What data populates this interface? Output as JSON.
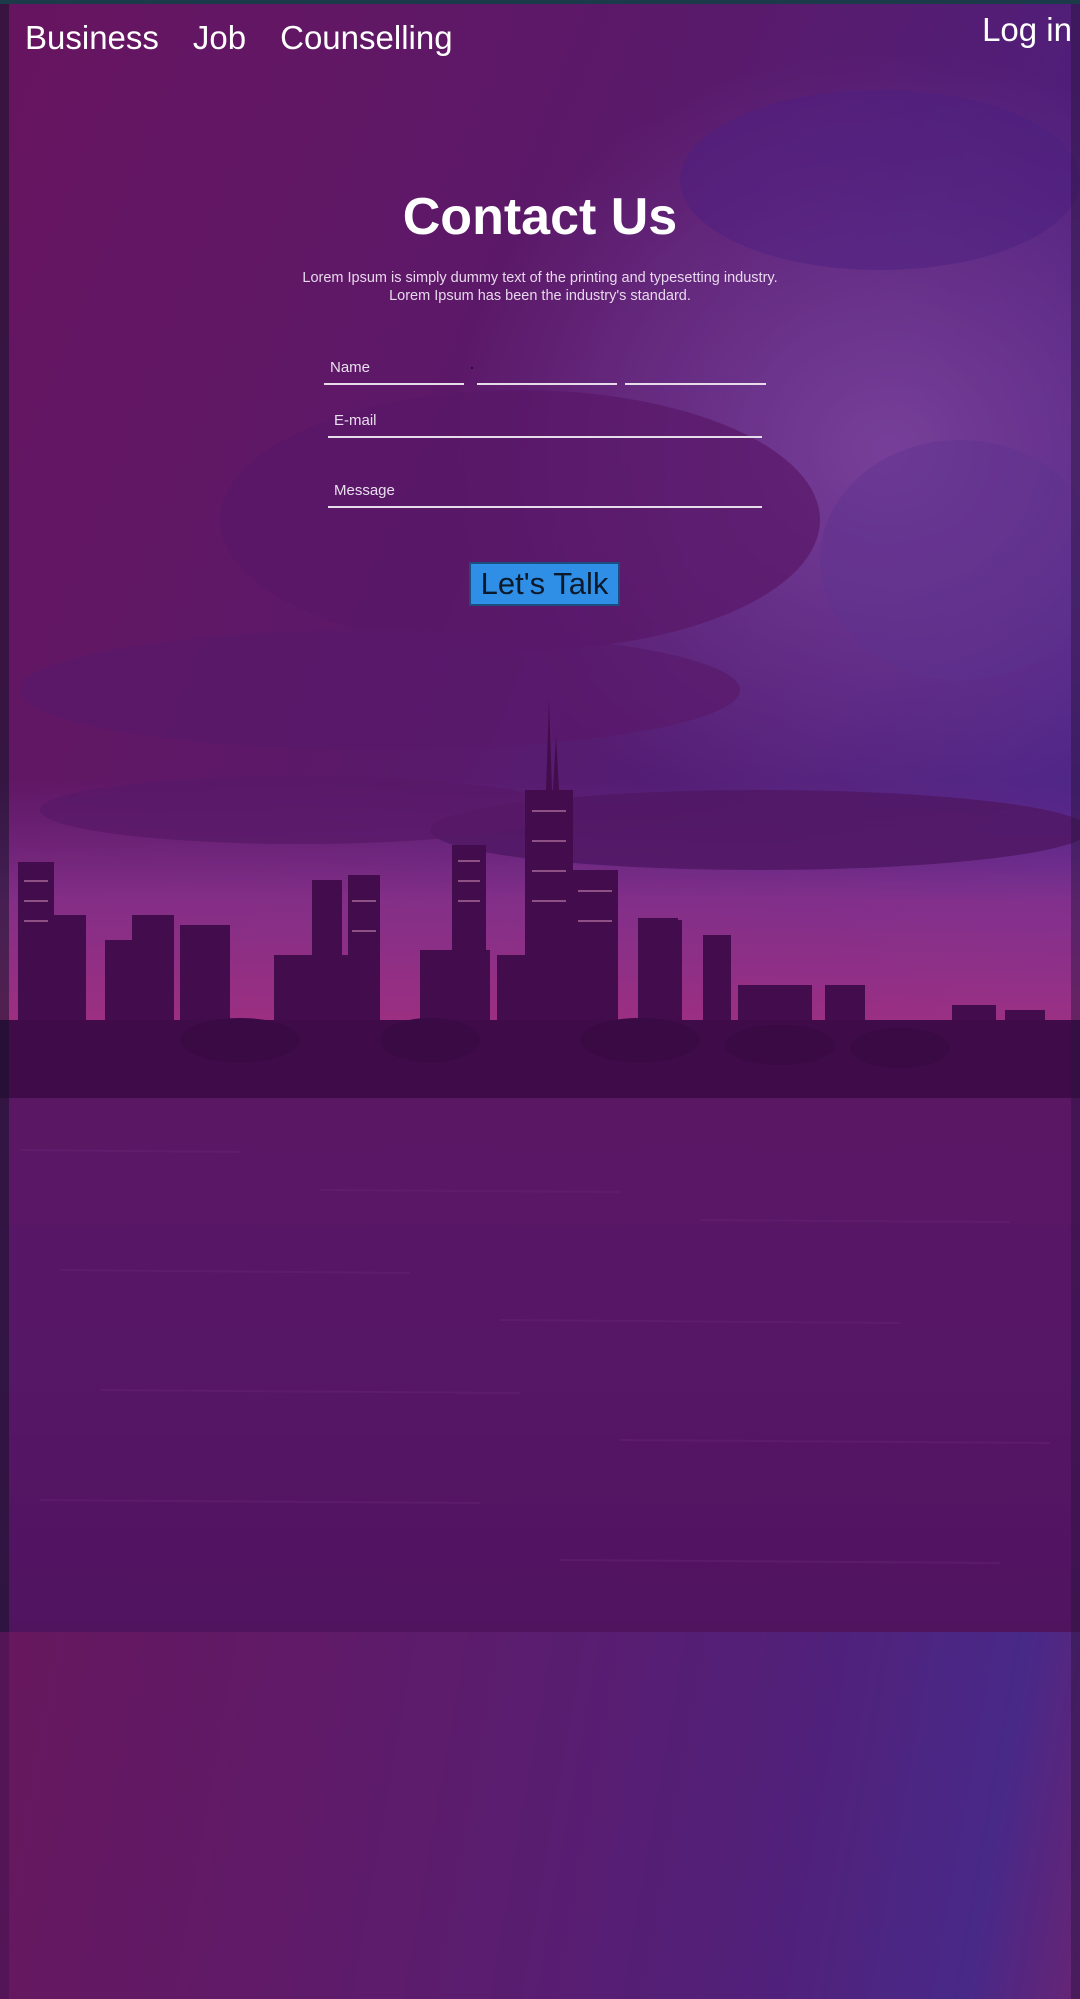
{
  "nav": {
    "items": [
      {
        "label": "Business"
      },
      {
        "label": "Job"
      },
      {
        "label": "Counselling"
      }
    ],
    "login_label": "Log in"
  },
  "contact": {
    "title": "Contact Us",
    "description": "Lorem Ipsum is simply dummy text of the printing and typesetting industry. Lorem Ipsum has been the industry's standard.",
    "fields": {
      "name_placeholder": "Name",
      "name2_placeholder": "",
      "name3_placeholder": "",
      "email_placeholder": "E-mail",
      "message_placeholder": "Message"
    },
    "submit_label": "Let's Talk"
  },
  "colors": {
    "button_bg": "#2f8ee6",
    "overlay": "#6a1a6e",
    "text": "#ffffff"
  }
}
